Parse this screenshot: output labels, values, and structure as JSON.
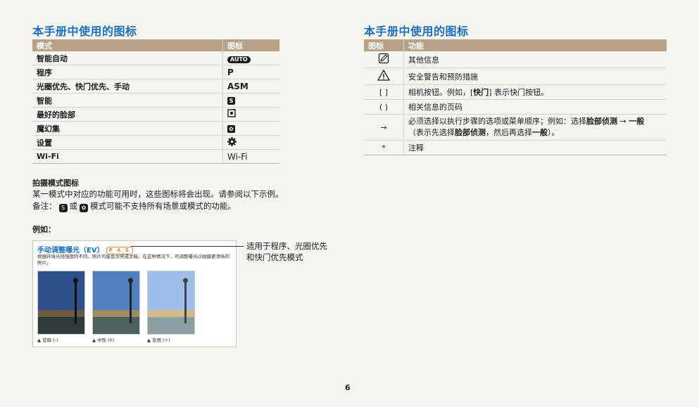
{
  "left": {
    "title": "本手册中使用的图标",
    "table_headers": [
      "模式",
      "图标"
    ],
    "rows": [
      {
        "mode": "智能自动",
        "icon": "AUTO"
      },
      {
        "mode": "程序",
        "icon": "P"
      },
      {
        "mode": "光圈优先、快门优先、手动",
        "icon": "ASM"
      },
      {
        "mode": "智能",
        "icon": "S"
      },
      {
        "mode": "最好的脸部",
        "icon": "face-icon"
      },
      {
        "mode": "魔幻集",
        "icon": "magic-icon"
      },
      {
        "mode": "设置",
        "icon": "gear-icon"
      },
      {
        "mode": "Wi-Fi",
        "icon": "Wi-Fi"
      }
    ],
    "shoot_heading": "拍摄模式图标",
    "shoot_line1": "某一模式中对应的功能可用时，这些图标将会出现。请参阅以下示例。",
    "shoot_line2_a": "备注：",
    "shoot_line2_b": "或",
    "shoot_line2_c": "模式可能不支持所有场景或模式的功能。",
    "example_label": "例如：",
    "example": {
      "title": "手动调整曝光（EV）",
      "badge": "P A S",
      "desc": "根据环境光线强度的不同，照片可能会太亮或太暗。在这种情况下，可调整曝光以拍摄更清晰的照片。",
      "captions": [
        "▲ 变暗 (-)",
        "▲ 中性 (0)",
        "▲ 变亮 (+)"
      ]
    },
    "callout": [
      "适用于程序、光圈优先",
      "和快门优先模式"
    ]
  },
  "right": {
    "title": "本手册中使用的图标",
    "table_headers": [
      "图标",
      "功能"
    ],
    "rows": [
      {
        "symbol": "note-icon",
        "desc": "其他信息"
      },
      {
        "symbol": "warning-icon",
        "desc": "安全警告和预防措施"
      },
      {
        "symbol": "[ ]",
        "desc_a": "相机按钮。例如，[",
        "desc_b": "快门",
        "desc_c": "] 表示快门按钮。"
      },
      {
        "symbol": "( )",
        "desc": "相关信息的页码"
      },
      {
        "symbol": "→",
        "desc_1a": "必须选择以执行步骤的选项或菜单顺序；例如：选择",
        "desc_1b": "脸部侦测",
        "desc_1c": " → ",
        "desc_1d": "一般",
        "desc_2a": "（表示先选择",
        "desc_2b": "脸部侦测",
        "desc_2c": "，然后再选择",
        "desc_2d": "一般",
        "desc_2e": "）。"
      },
      {
        "symbol": "*",
        "desc": "注释"
      }
    ]
  },
  "page_number": "6"
}
